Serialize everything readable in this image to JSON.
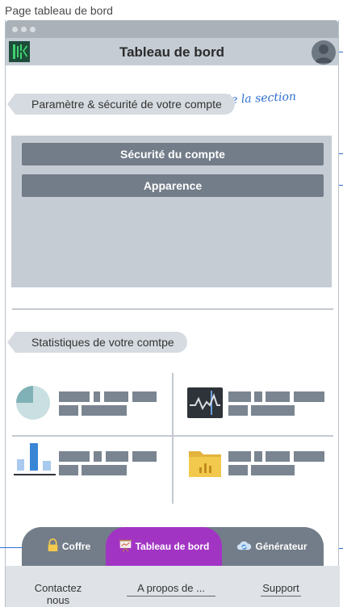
{
  "page_caption": "Page tableau de bord",
  "app": {
    "title": "Tableau de bord"
  },
  "annotation": "titre de la section",
  "sections": {
    "account": "Paramètre & sécurité de votre compte",
    "stats": "Statistiques de votre comtpe"
  },
  "settings_buttons": [
    "Sécurité du compte",
    "Apparence"
  ],
  "icons": {
    "logo": "grid-logo-icon",
    "avatar": "user-avatar-icon",
    "stat_1": "pie-chart-icon",
    "stat_2": "pulse-chart-icon",
    "stat_3": "bar-chart-icon",
    "stat_4": "folder-chart-icon",
    "tab_1": "padlock-icon",
    "tab_2": "presentation-board-icon",
    "tab_3": "cloud-sync-icon"
  },
  "tabs": [
    "Coffre",
    "Tableau de bord",
    "Générateur"
  ],
  "footer_links": [
    "Contactez nous",
    "A propos de ...",
    "Support"
  ],
  "colors": {
    "accent": "#a234c4",
    "panel": "#c5ccd4",
    "button": "#737d89",
    "annotation": "#2f6fd1"
  }
}
